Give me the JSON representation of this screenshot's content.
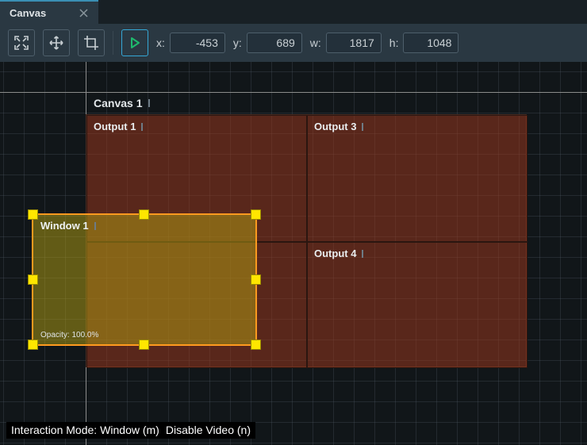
{
  "tab": {
    "title": "Canvas"
  },
  "toolbar": {
    "labels": {
      "x": "x:",
      "y": "y:",
      "w": "w:",
      "h": "h:"
    },
    "values": {
      "x": "-453",
      "y": "689",
      "w": "1817",
      "h": "1048"
    },
    "icons": {
      "fit": "fit-extents-icon",
      "move": "move-icon",
      "crop": "crop-icon",
      "play": "play-icon"
    }
  },
  "canvas": {
    "label": "Canvas 1",
    "outputs": [
      {
        "id": 1,
        "label": "Output 1"
      },
      {
        "id": 2,
        "label": ""
      },
      {
        "id": 3,
        "label": "Output 3"
      },
      {
        "id": 4,
        "label": "Output 4"
      }
    ],
    "window": {
      "label": "Window 1",
      "opacity": "Opacity: 100.0%"
    }
  },
  "status": {
    "prefix": "Interaction Mode: ",
    "mode": "Window (m)",
    "separator": " ",
    "extra": "Disable Video (n)"
  }
}
